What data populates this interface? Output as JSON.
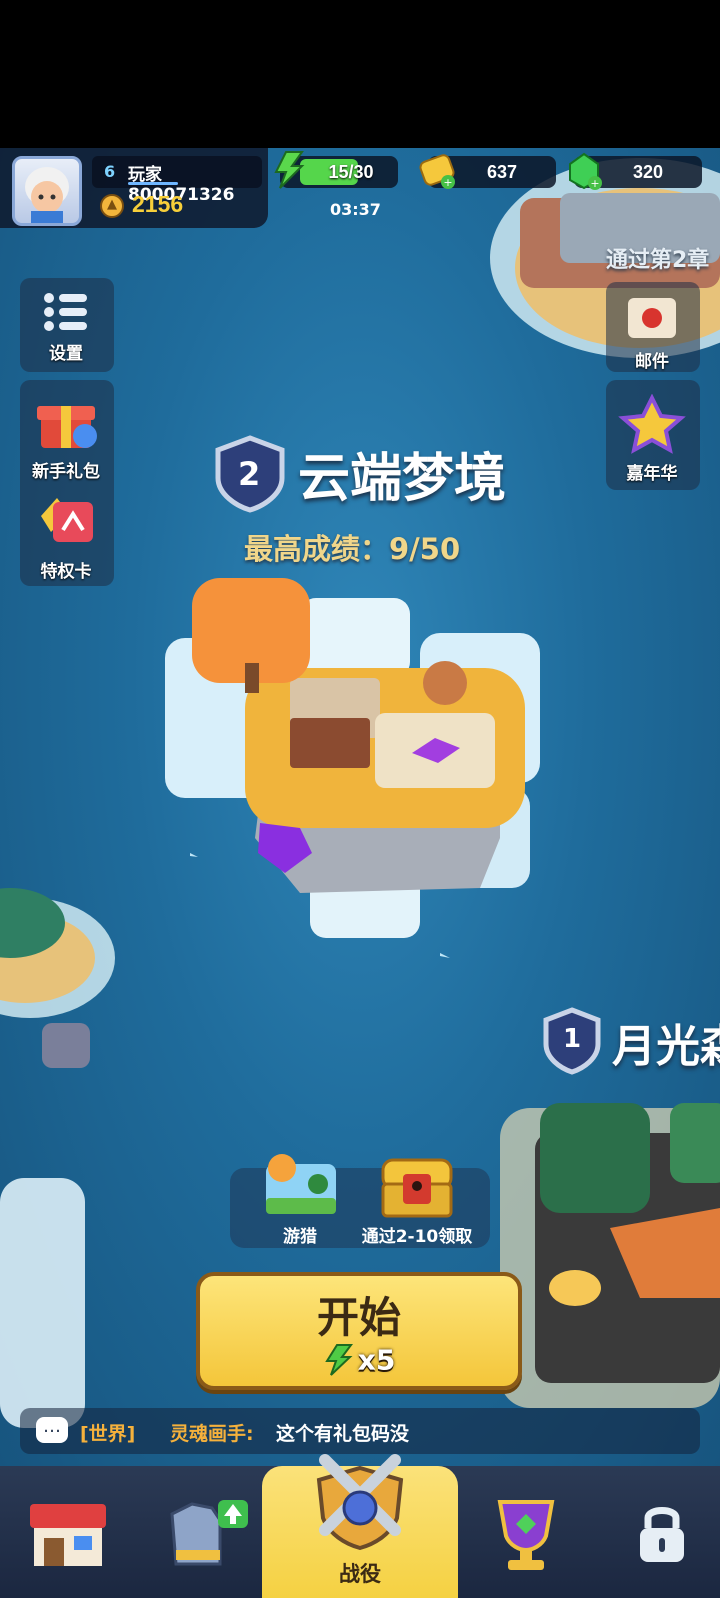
{
  "player": {
    "level": "6",
    "name": "玩家800071326",
    "power": "2156"
  },
  "resources": {
    "energy": "15/30",
    "energy_timer": "03:37",
    "gold": "637",
    "gems": "320"
  },
  "side_menu_left": [
    {
      "label": "设置",
      "icon": "menu-list-icon"
    },
    {
      "label": "新手礼包",
      "icon": "gift-box-icon"
    },
    {
      "label": "特权卡",
      "icon": "privilege-card-icon"
    }
  ],
  "side_menu_right": [
    {
      "label": "邮件",
      "icon": "mail-icon"
    },
    {
      "label": "嘉年华",
      "icon": "star-icon"
    }
  ],
  "current_stage": {
    "number": "2",
    "name": "云端梦境",
    "best_score": "最高成绩：9/50"
  },
  "next_stage": {
    "number": "1",
    "name": "月光森"
  },
  "locked_stage_hint": "通过第2章",
  "rewards": [
    {
      "label": "游猎",
      "icon": "safari-icon"
    },
    {
      "label": "通过2-10领取",
      "icon": "treasure-chest-icon"
    }
  ],
  "start_button": {
    "label": "开始",
    "cost": "x5"
  },
  "chat": {
    "channel": "[世界]",
    "sender": "灵魂画手:",
    "message": "这个有礼包码没"
  },
  "bottom_nav": [
    {
      "label": "",
      "icon": "shop-icon"
    },
    {
      "label": "",
      "icon": "armor-icon"
    },
    {
      "label": "战役",
      "icon": "crossed-swords-icon",
      "active": true
    },
    {
      "label": "",
      "icon": "trophy-icon"
    },
    {
      "label": "",
      "icon": "lock-icon"
    }
  ],
  "colors": {
    "accent_yellow": "#f7cf3a",
    "energy_green": "#55d64b",
    "sea_blue": "#2678a8",
    "nav_active": "#f5d142"
  }
}
